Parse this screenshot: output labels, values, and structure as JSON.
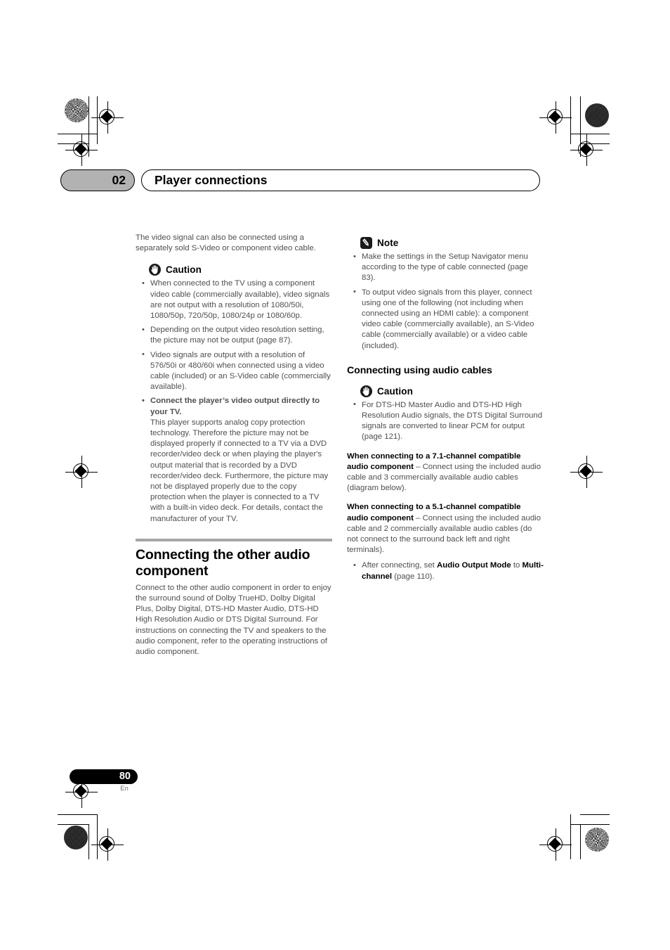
{
  "header": {
    "chapter_number": "02",
    "chapter_title": "Player connections"
  },
  "left_column": {
    "intro": "The video signal can also be connected using a separately sold S-Video or component video cable.",
    "caution": {
      "icon": "caution-hand-icon",
      "label": "Caution",
      "items": [
        "When connected to the TV using a component video cable (commercially available), video signals are not output with a resolution of 1080/50i, 1080/50p, 720/50p, 1080/24p or 1080/60p.",
        "Depending on the output video resolution setting, the picture may not be output (page 87).",
        "Video signals are output with a resolution of 576/50i or 480/60i when connected using a video cable (included) or an S-Video cable (commercially available)."
      ],
      "bold_item_lead": "Connect the player’s video output directly to your TV.",
      "bold_item_body": "This player supports analog copy protection technology. Therefore the picture may not be displayed properly if connected to a TV via a DVD recorder/video deck or when playing the player's output material that is recorded by a DVD recorder/video deck. Furthermore, the picture may not be displayed properly due to the copy protection when the player is connected to a TV with a built-in video deck. For details, contact the manufacturer of your TV."
    },
    "section": {
      "title": "Connecting the other audio component",
      "body": "Connect to the other audio component in order to enjoy the surround sound of Dolby TrueHD, Dolby Digital Plus, Dolby Digital, DTS-HD Master Audio, DTS-HD High Resolution Audio or DTS Digital Surround. For instructions on connecting the TV and speakers to the audio component, refer to the operating instructions of audio component."
    }
  },
  "right_column": {
    "note": {
      "icon": "note-pencil-icon",
      "label": "Note",
      "items": [
        "Make the settings in the Setup Navigator menu according to the type of cable connected (page 83).",
        "To output video signals from this player, connect using one of the following (not including when connected using an HDMI cable): a component video cable (commercially available), an S-Video cable (commercially available) or a video cable (included)."
      ]
    },
    "subsection_title": "Connecting using audio cables",
    "caution": {
      "icon": "caution-hand-icon",
      "label": "Caution",
      "items": [
        "For DTS-HD Master Audio and DTS-HD High Resolution Audio signals, the DTS Digital Surround signals are converted to linear PCM for output (page 121)."
      ]
    },
    "paragraphs": [
      {
        "bold_lead": "When connecting to a 7.1-channel compatible audio component",
        "rest": " – Connect using the included audio cable and 3 commercially available audio cables (diagram below)."
      },
      {
        "bold_lead": "When connecting to a 5.1-channel compatible audio component",
        "rest": " – Connect using the included audio cable and 2 commercially available audio cables (do not connect to the surround back left and right terminals)."
      }
    ],
    "final_bullet": {
      "pre": "After connecting, set ",
      "bold1": "Audio Output Mode",
      "mid": " to ",
      "bold2": "Multi-channel",
      "post": " (page 110)."
    }
  },
  "footer": {
    "page_number": "80",
    "language": "En"
  },
  "colors": {
    "badge_gray": "#b2b2b2",
    "rule_gray": "#a6a6a6",
    "body_text": "#4f4f4f",
    "heading_black": "#000000"
  }
}
